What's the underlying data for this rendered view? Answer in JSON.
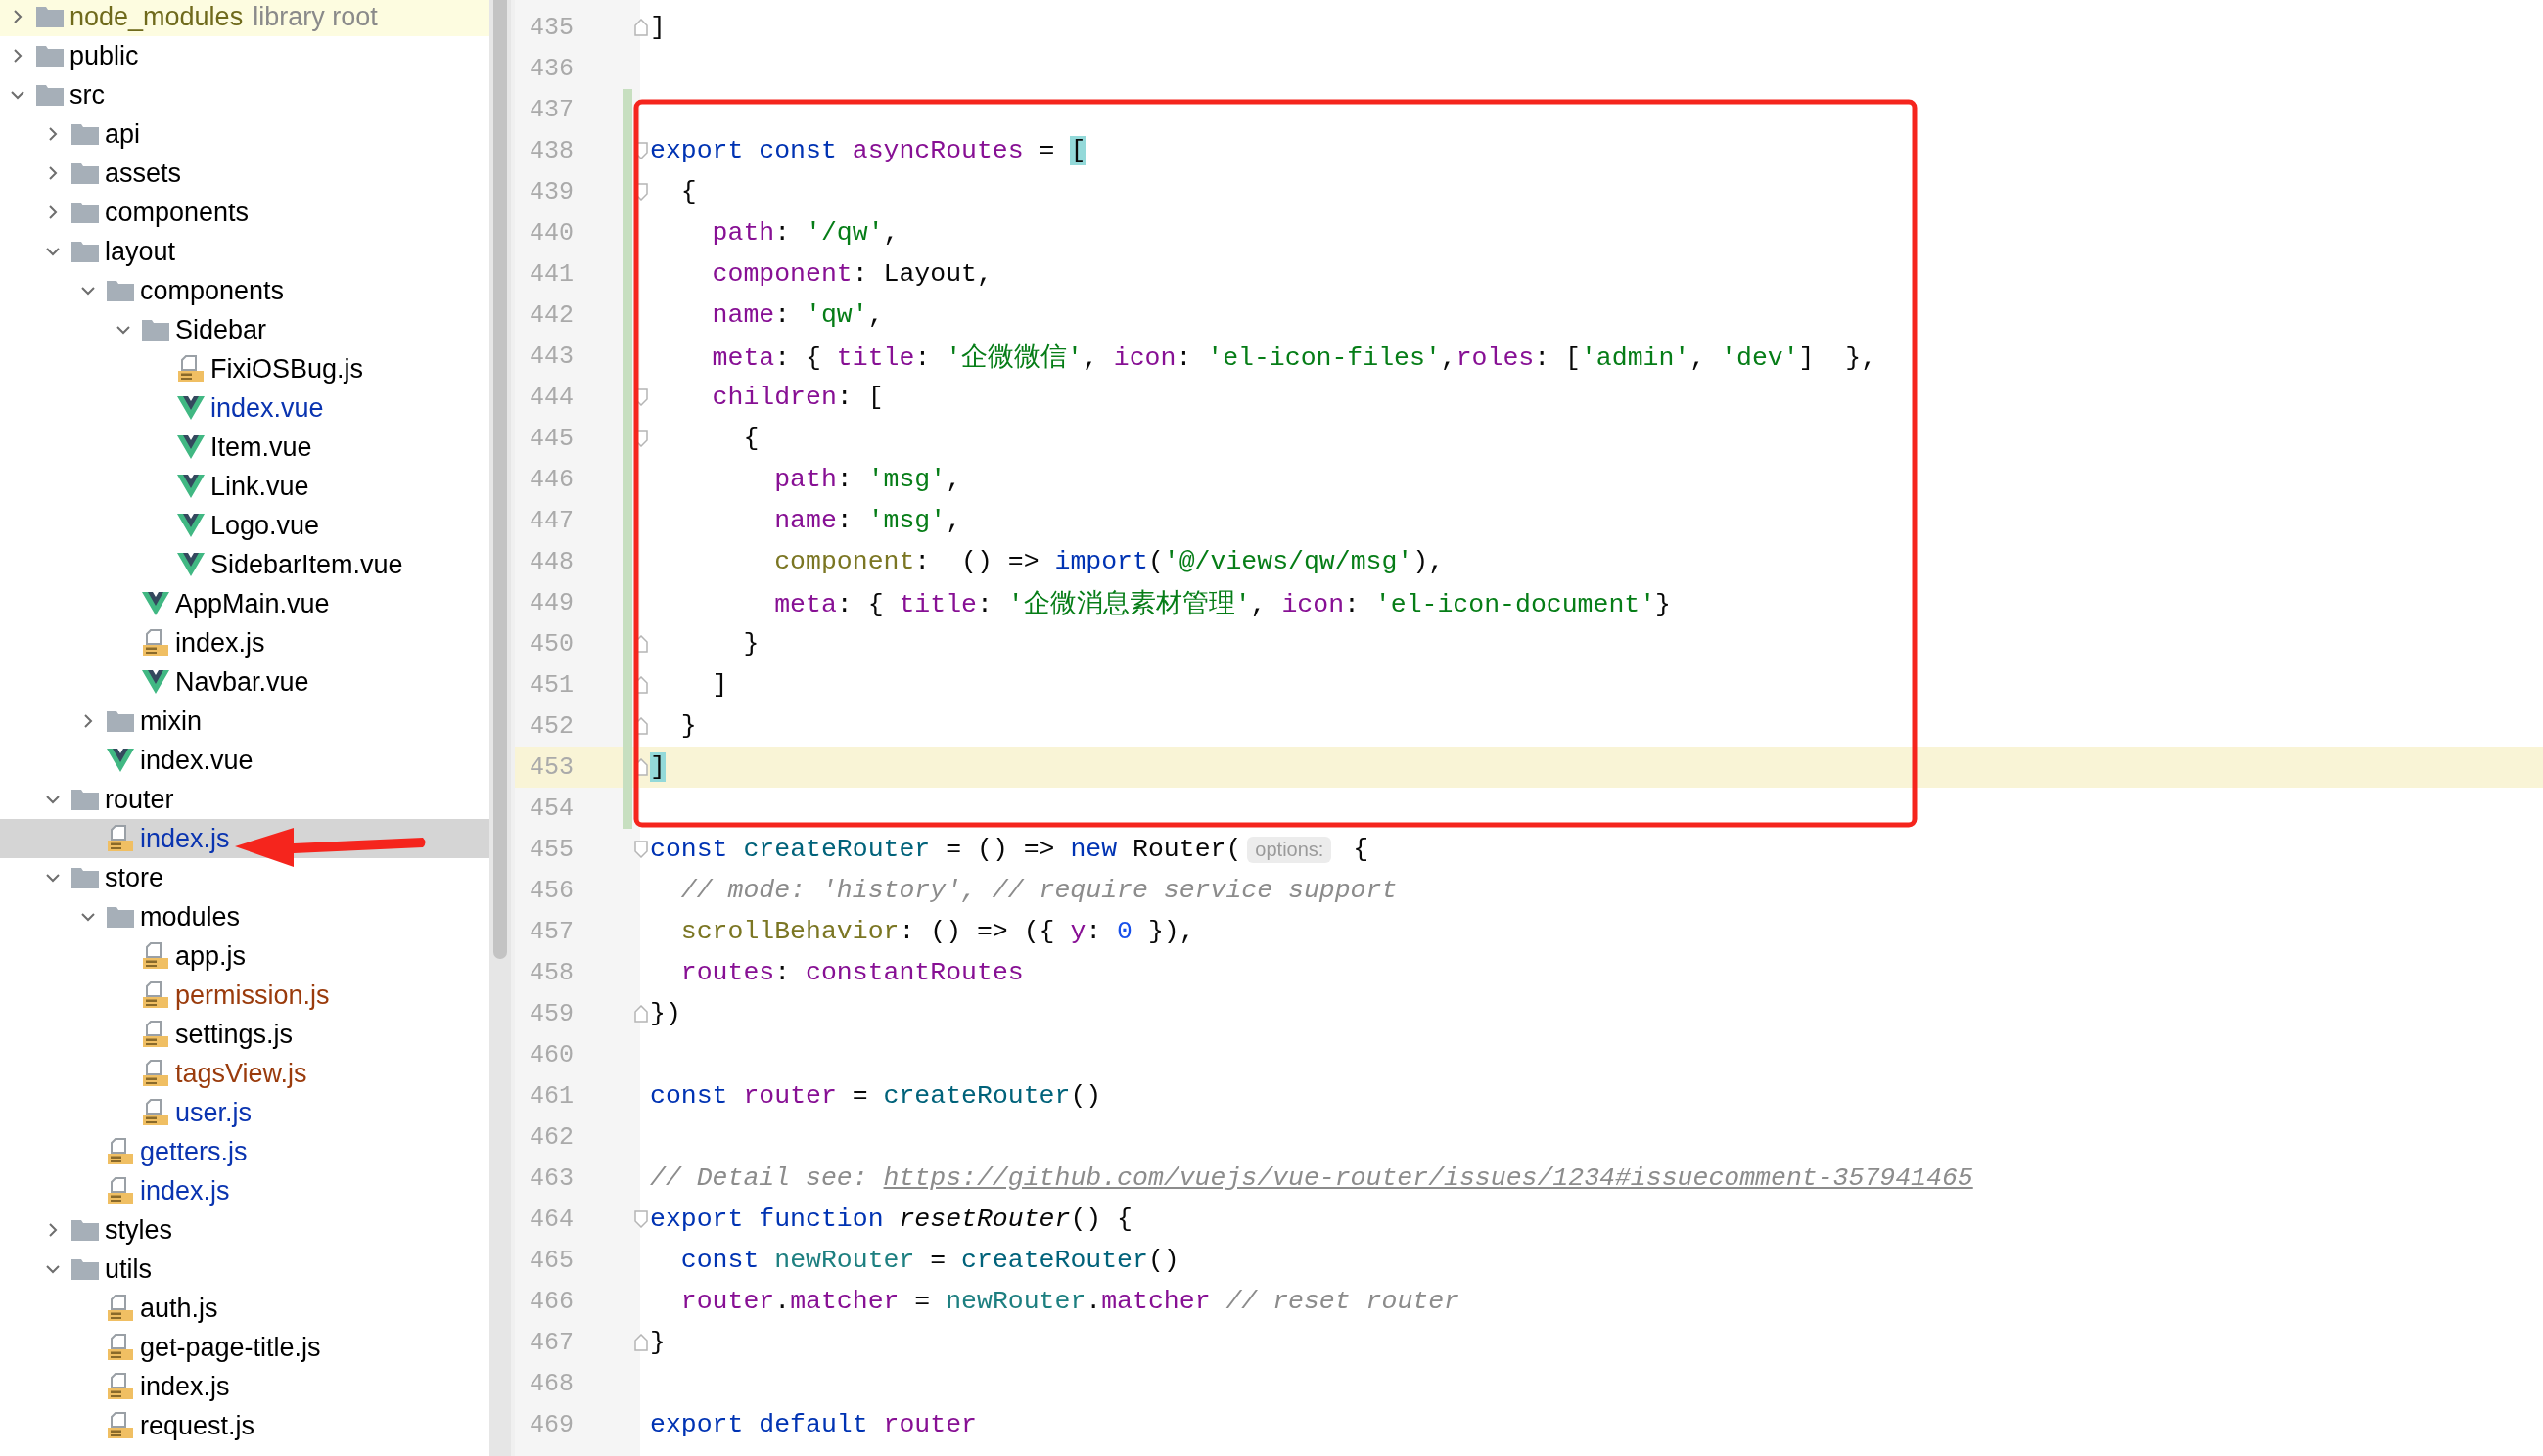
{
  "project_tree": [
    {
      "kind": "folder",
      "name": "node_modules",
      "suffix": "library root",
      "library": true,
      "expanded": false,
      "selected": false,
      "color": "#6f6a1c"
    },
    {
      "kind": "folder",
      "name": "public",
      "expanded": false,
      "selected": false,
      "color": "#000000"
    },
    {
      "kind": "folder",
      "name": "src",
      "expanded": true,
      "selected": false,
      "color": "#000000",
      "children": [
        {
          "kind": "folder",
          "name": "api",
          "expanded": false,
          "selected": false,
          "color": "#000000"
        },
        {
          "kind": "folder",
          "name": "assets",
          "expanded": false,
          "selected": false,
          "color": "#000000"
        },
        {
          "kind": "folder",
          "name": "components",
          "expanded": false,
          "selected": false,
          "color": "#000000"
        },
        {
          "kind": "folder",
          "name": "layout",
          "expanded": true,
          "selected": false,
          "color": "#000000",
          "children": [
            {
              "kind": "folder",
              "name": "components",
              "expanded": true,
              "selected": false,
              "color": "#000000",
              "children": [
                {
                  "kind": "folder",
                  "name": "Sidebar",
                  "expanded": true,
                  "selected": false,
                  "color": "#000000",
                  "children": [
                    {
                      "kind": "js",
                      "name": "FixiOSBug.js",
                      "selected": false,
                      "color": "#000000"
                    },
                    {
                      "kind": "vue",
                      "name": "index.vue",
                      "selected": false,
                      "color": "#0a34b0"
                    },
                    {
                      "kind": "vue",
                      "name": "Item.vue",
                      "selected": false,
                      "color": "#000000"
                    },
                    {
                      "kind": "vue",
                      "name": "Link.vue",
                      "selected": false,
                      "color": "#000000"
                    },
                    {
                      "kind": "vue",
                      "name": "Logo.vue",
                      "selected": false,
                      "color": "#000000"
                    },
                    {
                      "kind": "vue",
                      "name": "SidebarItem.vue",
                      "selected": false,
                      "color": "#000000"
                    }
                  ]
                },
                {
                  "kind": "vue",
                  "name": "AppMain.vue",
                  "selected": false,
                  "color": "#000000"
                },
                {
                  "kind": "js",
                  "name": "index.js",
                  "selected": false,
                  "color": "#000000"
                },
                {
                  "kind": "vue",
                  "name": "Navbar.vue",
                  "selected": false,
                  "color": "#000000"
                }
              ]
            },
            {
              "kind": "folder",
              "name": "mixin",
              "expanded": false,
              "selected": false,
              "color": "#000000"
            },
            {
              "kind": "vue",
              "name": "index.vue",
              "selected": false,
              "color": "#000000"
            }
          ]
        },
        {
          "kind": "folder",
          "name": "router",
          "expanded": true,
          "selected": false,
          "color": "#000000",
          "children": [
            {
              "kind": "js",
              "name": "index.js",
              "selected": true,
              "color": "#0a34b0"
            }
          ]
        },
        {
          "kind": "folder",
          "name": "store",
          "expanded": true,
          "selected": false,
          "color": "#000000",
          "children": [
            {
              "kind": "folder",
              "name": "modules",
              "expanded": true,
              "selected": false,
              "color": "#000000",
              "children": [
                {
                  "kind": "js",
                  "name": "app.js",
                  "selected": false,
                  "color": "#000000"
                },
                {
                  "kind": "js",
                  "name": "permission.js",
                  "selected": false,
                  "color": "#9a3b0c"
                },
                {
                  "kind": "js",
                  "name": "settings.js",
                  "selected": false,
                  "color": "#000000"
                },
                {
                  "kind": "js",
                  "name": "tagsView.js",
                  "selected": false,
                  "color": "#9a3b0c"
                },
                {
                  "kind": "js",
                  "name": "user.js",
                  "selected": false,
                  "color": "#0a34b0"
                }
              ]
            },
            {
              "kind": "js",
              "name": "getters.js",
              "selected": false,
              "color": "#0a34b0"
            },
            {
              "kind": "js",
              "name": "index.js",
              "selected": false,
              "color": "#0a34b0"
            }
          ]
        },
        {
          "kind": "folder",
          "name": "styles",
          "expanded": false,
          "selected": false,
          "color": "#000000"
        },
        {
          "kind": "folder",
          "name": "utils",
          "expanded": true,
          "selected": false,
          "color": "#000000",
          "children": [
            {
              "kind": "js",
              "name": "auth.js",
              "selected": false,
              "color": "#000000"
            },
            {
              "kind": "js",
              "name": "get-page-title.js",
              "selected": false,
              "color": "#000000"
            },
            {
              "kind": "js",
              "name": "index.js",
              "selected": false,
              "color": "#000000"
            },
            {
              "kind": "js",
              "name": "request.js",
              "selected": false,
              "color": "#000000"
            }
          ]
        }
      ]
    }
  ],
  "editor": {
    "lines": [
      {
        "number": "435",
        "current": false,
        "changed": false,
        "kind": "fold_end",
        "tokens": [
          {
            "kind": "plain",
            "text": "]"
          }
        ]
      },
      {
        "number": "436",
        "current": false,
        "changed": false,
        "kind": "plain"
      },
      {
        "number": "437",
        "current": false,
        "changed": true,
        "kind": "plain"
      },
      {
        "number": "438",
        "current": false,
        "changed": true,
        "kind": "fold_start",
        "tokens": [
          {
            "kind": "keyword",
            "text": "export const "
          },
          {
            "kind": "property",
            "text": "asyncRoutes"
          },
          {
            "kind": "plain",
            "text": " = "
          },
          {
            "kind": "bracket",
            "text": "["
          }
        ]
      },
      {
        "number": "439",
        "current": false,
        "changed": true,
        "kind": "fold_start",
        "tokens": [
          {
            "kind": "plain",
            "text": "  {"
          }
        ]
      },
      {
        "number": "440",
        "current": false,
        "changed": true,
        "kind": "plain",
        "tokens": [
          {
            "kind": "property",
            "text": "    path"
          },
          {
            "kind": "plain",
            "text": ": "
          },
          {
            "kind": "string",
            "text": "'/qw'"
          },
          {
            "kind": "plain",
            "text": ","
          }
        ]
      },
      {
        "number": "441",
        "current": false,
        "changed": true,
        "kind": "plain",
        "tokens": [
          {
            "kind": "property",
            "text": "    component"
          },
          {
            "kind": "plain",
            "text": ": Layout,"
          }
        ]
      },
      {
        "number": "442",
        "current": false,
        "changed": true,
        "kind": "plain",
        "tokens": [
          {
            "kind": "property",
            "text": "    name"
          },
          {
            "kind": "plain",
            "text": ": "
          },
          {
            "kind": "string",
            "text": "'qw'"
          },
          {
            "kind": "plain",
            "text": ","
          }
        ]
      },
      {
        "number": "443",
        "current": false,
        "changed": true,
        "kind": "plain",
        "tokens": [
          {
            "kind": "property",
            "text": "    meta"
          },
          {
            "kind": "plain",
            "text": ": { "
          },
          {
            "kind": "property",
            "text": "title"
          },
          {
            "kind": "plain",
            "text": ": "
          },
          {
            "kind": "string",
            "text": "'企微微信'"
          },
          {
            "kind": "plain",
            "text": ", "
          },
          {
            "kind": "property",
            "text": "icon"
          },
          {
            "kind": "plain",
            "text": ": "
          },
          {
            "kind": "string",
            "text": "'el-icon-files'"
          },
          {
            "kind": "plain",
            "text": ","
          },
          {
            "kind": "property",
            "text": "roles"
          },
          {
            "kind": "plain",
            "text": ": ["
          },
          {
            "kind": "string",
            "text": "'admin'"
          },
          {
            "kind": "plain",
            "text": ", "
          },
          {
            "kind": "string",
            "text": "'dev'"
          },
          {
            "kind": "plain",
            "text": "]  },"
          }
        ]
      },
      {
        "number": "444",
        "current": false,
        "changed": true,
        "kind": "fold_start",
        "tokens": [
          {
            "kind": "property",
            "text": "    children"
          },
          {
            "kind": "plain",
            "text": ": ["
          }
        ]
      },
      {
        "number": "445",
        "current": false,
        "changed": true,
        "kind": "fold_start",
        "tokens": [
          {
            "kind": "plain",
            "text": "      {"
          }
        ]
      },
      {
        "number": "446",
        "current": false,
        "changed": true,
        "kind": "plain",
        "tokens": [
          {
            "kind": "property",
            "text": "        path"
          },
          {
            "kind": "plain",
            "text": ": "
          },
          {
            "kind": "string",
            "text": "'msg'"
          },
          {
            "kind": "plain",
            "text": ","
          }
        ]
      },
      {
        "number": "447",
        "current": false,
        "changed": true,
        "kind": "plain",
        "tokens": [
          {
            "kind": "property",
            "text": "        name"
          },
          {
            "kind": "plain",
            "text": ": "
          },
          {
            "kind": "string",
            "text": "'msg'"
          },
          {
            "kind": "plain",
            "text": ","
          }
        ]
      },
      {
        "number": "448",
        "current": false,
        "changed": true,
        "kind": "plain",
        "tokens": [
          {
            "kind": "olive",
            "text": "        component"
          },
          {
            "kind": "plain",
            "text": ":  () => "
          },
          {
            "kind": "keyword",
            "text": "import"
          },
          {
            "kind": "plain",
            "text": "("
          },
          {
            "kind": "string",
            "text": "'@/views/qw/msg'"
          },
          {
            "kind": "plain",
            "text": "),"
          }
        ]
      },
      {
        "number": "449",
        "current": false,
        "changed": true,
        "kind": "plain",
        "tokens": [
          {
            "kind": "property",
            "text": "        meta"
          },
          {
            "kind": "plain",
            "text": ": { "
          },
          {
            "kind": "property",
            "text": "title"
          },
          {
            "kind": "plain",
            "text": ": "
          },
          {
            "kind": "string",
            "text": "'企微消息素材管理'"
          },
          {
            "kind": "plain",
            "text": ", "
          },
          {
            "kind": "property",
            "text": "icon"
          },
          {
            "kind": "plain",
            "text": ": "
          },
          {
            "kind": "string",
            "text": "'el-icon-document'"
          },
          {
            "kind": "plain",
            "text": "}"
          }
        ]
      },
      {
        "number": "450",
        "current": false,
        "changed": true,
        "kind": "fold_end",
        "tokens": [
          {
            "kind": "plain",
            "text": "      }"
          }
        ]
      },
      {
        "number": "451",
        "current": false,
        "changed": true,
        "kind": "fold_end",
        "tokens": [
          {
            "kind": "plain",
            "text": "    ]"
          }
        ]
      },
      {
        "number": "452",
        "current": false,
        "changed": true,
        "kind": "fold_end",
        "tokens": [
          {
            "kind": "plain",
            "text": "  }"
          }
        ]
      },
      {
        "number": "453",
        "current": true,
        "changed": true,
        "kind": "fold_end",
        "tokens": [
          {
            "kind": "bracket",
            "text": "]"
          }
        ]
      },
      {
        "number": "454",
        "current": false,
        "changed": true,
        "kind": "plain"
      },
      {
        "number": "455",
        "current": false,
        "changed": false,
        "kind": "fold_start",
        "tokens": [
          {
            "kind": "keyword",
            "text": "const "
          },
          {
            "kind": "function",
            "text": "createRouter"
          },
          {
            "kind": "plain",
            "text": " = () => "
          },
          {
            "kind": "keyword",
            "text": "new "
          },
          {
            "kind": "plain",
            "text": "Router("
          },
          {
            "kind": "hint",
            "text": "options:"
          },
          {
            "kind": "plain",
            "text": " {"
          }
        ]
      },
      {
        "number": "456",
        "current": false,
        "changed": false,
        "kind": "plain",
        "tokens": [
          {
            "kind": "comment",
            "text": "  // mode: 'history', // require service support"
          }
        ]
      },
      {
        "number": "457",
        "current": false,
        "changed": false,
        "kind": "plain",
        "tokens": [
          {
            "kind": "olive",
            "text": "  scrollBehavior"
          },
          {
            "kind": "plain",
            "text": ": () => ({ "
          },
          {
            "kind": "property",
            "text": "y"
          },
          {
            "kind": "plain",
            "text": ": "
          },
          {
            "kind": "number",
            "text": "0"
          },
          {
            "kind": "plain",
            "text": " }),"
          }
        ]
      },
      {
        "number": "458",
        "current": false,
        "changed": false,
        "kind": "plain",
        "tokens": [
          {
            "kind": "property",
            "text": "  routes"
          },
          {
            "kind": "plain",
            "text": ": "
          },
          {
            "kind": "property",
            "text": "constantRoutes"
          }
        ]
      },
      {
        "number": "459",
        "current": false,
        "changed": false,
        "kind": "fold_end",
        "tokens": [
          {
            "kind": "plain",
            "text": "})"
          }
        ]
      },
      {
        "number": "460",
        "current": false,
        "changed": false,
        "kind": "plain"
      },
      {
        "number": "461",
        "current": false,
        "changed": false,
        "kind": "plain",
        "tokens": [
          {
            "kind": "keyword",
            "text": "const "
          },
          {
            "kind": "property",
            "text": "router"
          },
          {
            "kind": "plain",
            "text": " = "
          },
          {
            "kind": "function",
            "text": "createRouter"
          },
          {
            "kind": "plain",
            "text": "()"
          }
        ]
      },
      {
        "number": "462",
        "current": false,
        "changed": false,
        "kind": "plain"
      },
      {
        "number": "463",
        "current": false,
        "changed": false,
        "kind": "plain",
        "tokens": [
          {
            "kind": "comment",
            "text": "// Detail see: "
          },
          {
            "kind": "link",
            "text": "https://github.com/vuejs/vue-router/issues/1234#issuecomment-357941465"
          }
        ]
      },
      {
        "number": "464",
        "current": false,
        "changed": false,
        "kind": "fold_start",
        "tokens": [
          {
            "kind": "keyword",
            "text": "export function "
          },
          {
            "kind": "declaration",
            "text": "resetRouter"
          },
          {
            "kind": "plain",
            "text": "() {"
          }
        ]
      },
      {
        "number": "465",
        "current": false,
        "changed": false,
        "kind": "plain",
        "tokens": [
          {
            "kind": "keyword",
            "text": "  const "
          },
          {
            "kind": "local",
            "text": "newRouter"
          },
          {
            "kind": "plain",
            "text": " = "
          },
          {
            "kind": "function",
            "text": "createRouter"
          },
          {
            "kind": "plain",
            "text": "()"
          }
        ]
      },
      {
        "number": "466",
        "current": false,
        "changed": false,
        "kind": "plain",
        "tokens": [
          {
            "kind": "property",
            "text": "  router"
          },
          {
            "kind": "plain",
            "text": "."
          },
          {
            "kind": "property",
            "text": "matcher"
          },
          {
            "kind": "plain",
            "text": " = "
          },
          {
            "kind": "local",
            "text": "newRouter"
          },
          {
            "kind": "plain",
            "text": "."
          },
          {
            "kind": "property",
            "text": "matcher"
          },
          {
            "kind": "comment",
            "text": " // reset router"
          }
        ]
      },
      {
        "number": "467",
        "current": false,
        "changed": false,
        "kind": "fold_end",
        "tokens": [
          {
            "kind": "plain",
            "text": "}"
          }
        ]
      },
      {
        "number": "468",
        "current": false,
        "changed": false,
        "kind": "plain"
      },
      {
        "number": "469",
        "current": false,
        "changed": false,
        "kind": "plain",
        "tokens": [
          {
            "kind": "keyword",
            "text": "export default "
          },
          {
            "kind": "property",
            "text": "router"
          }
        ]
      }
    ]
  }
}
